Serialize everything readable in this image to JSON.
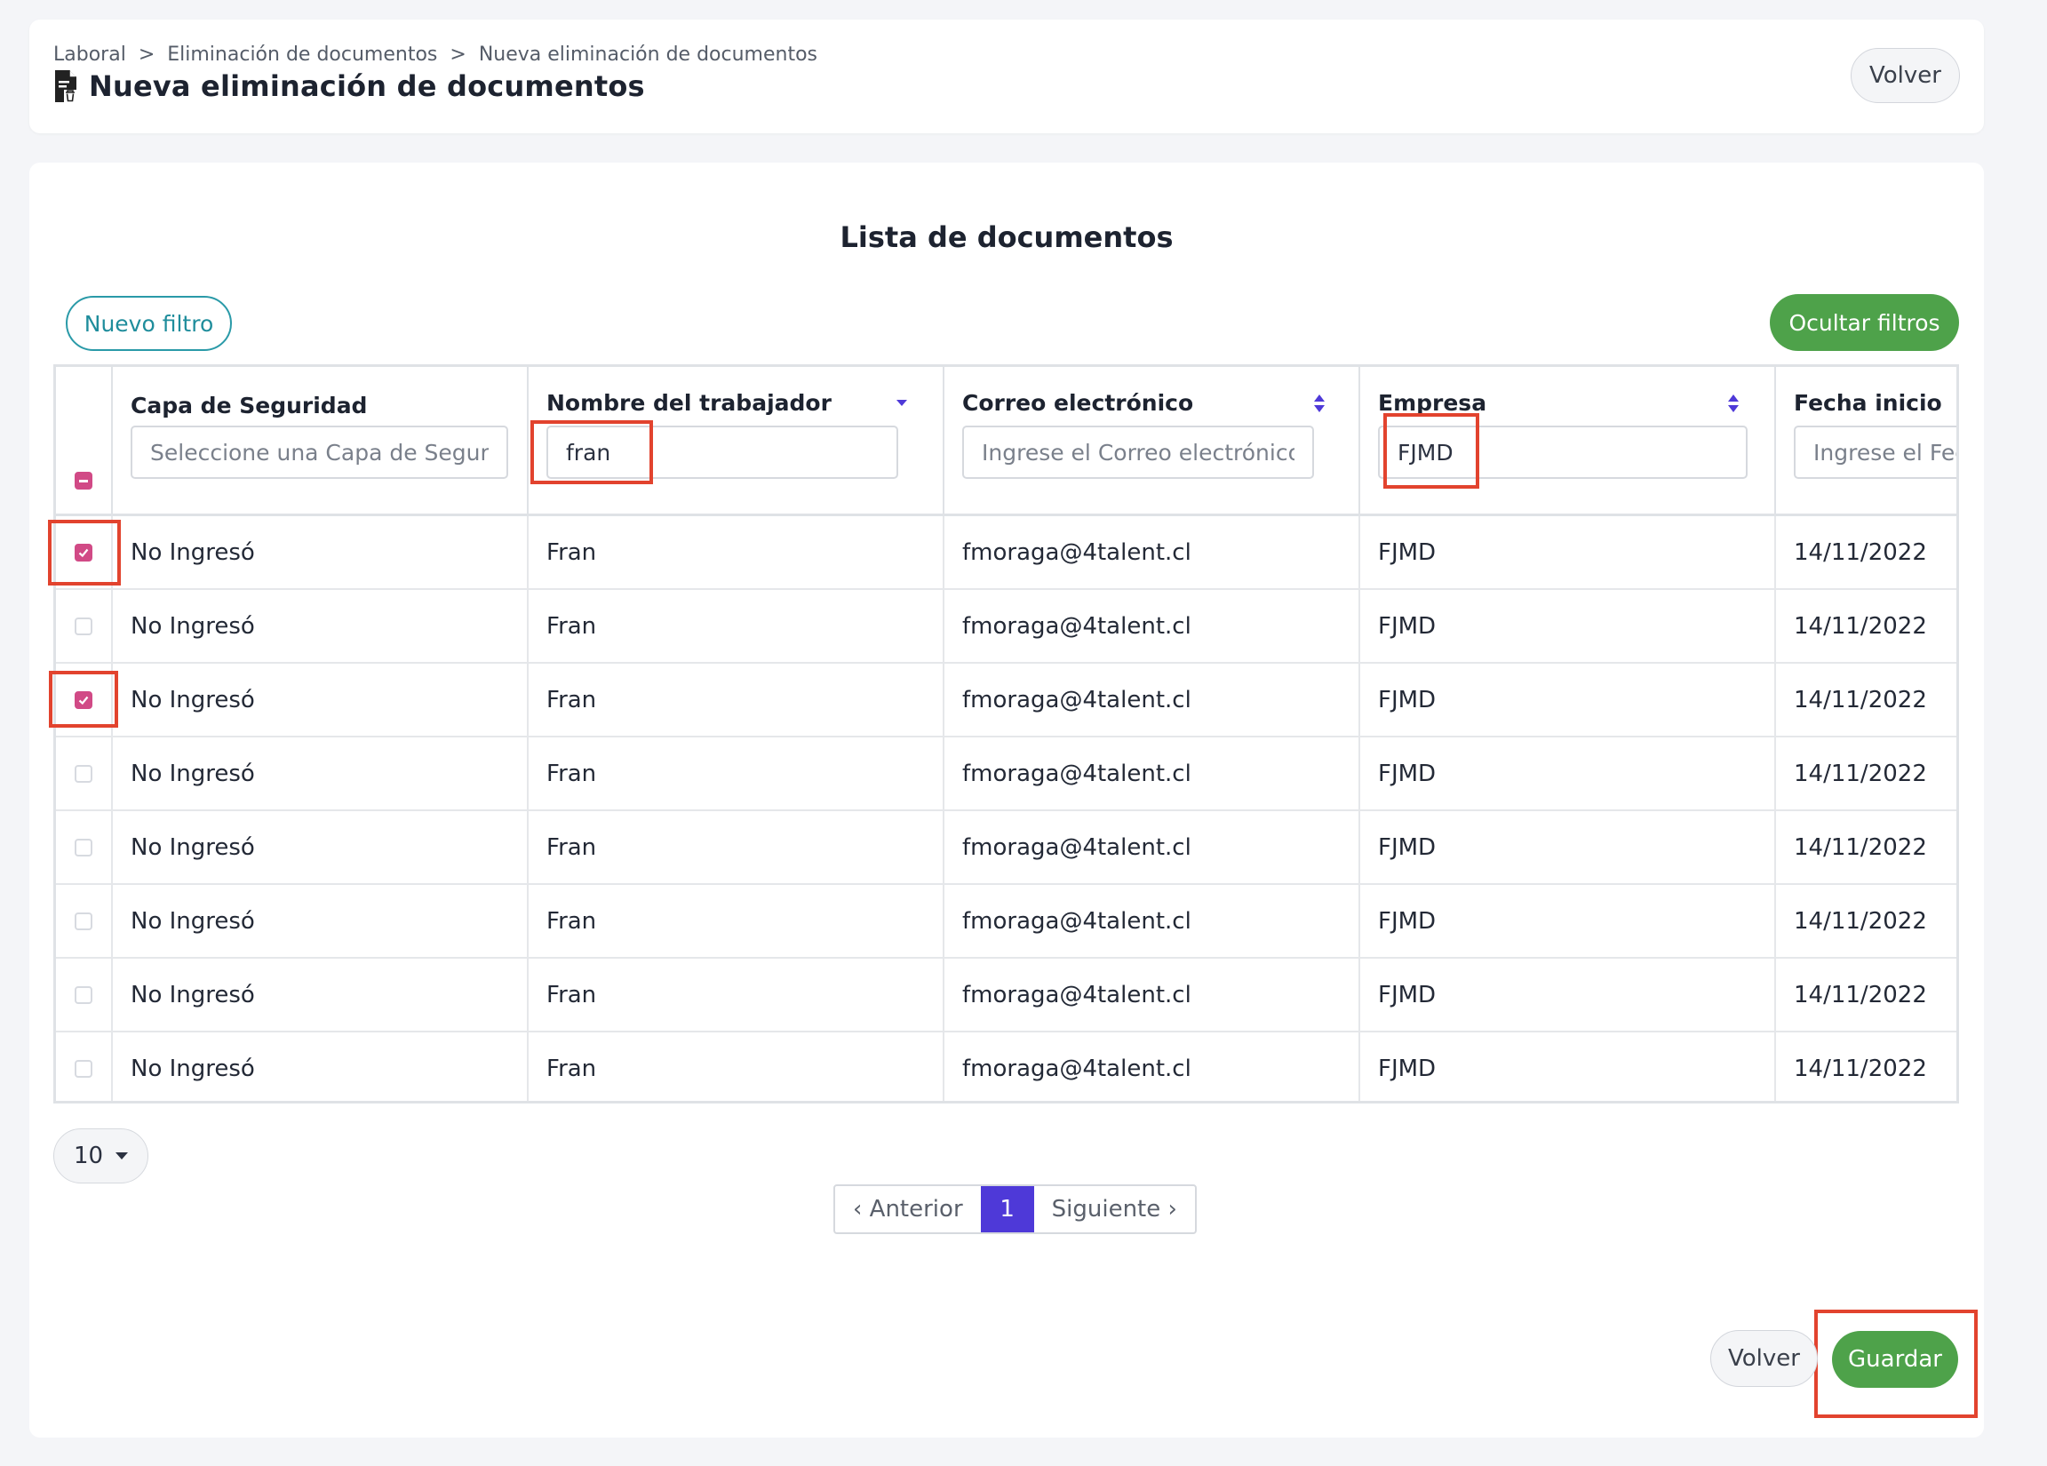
{
  "breadcrumb": [
    "Laboral",
    "Eliminación de documentos",
    "Nueva eliminación de documentos"
  ],
  "breadcrumb_separator": ">",
  "page_title": "Nueva eliminación de documentos",
  "header_back_label": "Volver",
  "section_title": "Lista de documentos",
  "new_filter_label": "Nuevo filtro",
  "hide_filters_label": "Ocultar filtros",
  "table": {
    "columns": [
      {
        "label": "Capa de Seguridad",
        "placeholder": "Seleccione una Capa de Seguridad",
        "value": ""
      },
      {
        "label": "Nombre del trabajador",
        "placeholder": "",
        "value": "fran"
      },
      {
        "label": "Correo electrónico",
        "placeholder": "Ingrese el Correo electrónico",
        "value": ""
      },
      {
        "label": "Empresa",
        "placeholder": "",
        "value": "FJMD"
      },
      {
        "label": "Fecha inicio",
        "placeholder": "Ingrese el Fecha inicio",
        "value": ""
      }
    ],
    "select_all_state": "indeterminate",
    "rows": [
      {
        "checked": true,
        "capa": "No Ingresó",
        "nombre": "Fran",
        "correo": "fmoraga@4talent.cl",
        "empresa": "FJMD",
        "fecha": "14/11/2022"
      },
      {
        "checked": false,
        "capa": "No Ingresó",
        "nombre": "Fran",
        "correo": "fmoraga@4talent.cl",
        "empresa": "FJMD",
        "fecha": "14/11/2022"
      },
      {
        "checked": true,
        "capa": "No Ingresó",
        "nombre": "Fran",
        "correo": "fmoraga@4talent.cl",
        "empresa": "FJMD",
        "fecha": "14/11/2022"
      },
      {
        "checked": false,
        "capa": "No Ingresó",
        "nombre": "Fran",
        "correo": "fmoraga@4talent.cl",
        "empresa": "FJMD",
        "fecha": "14/11/2022"
      },
      {
        "checked": false,
        "capa": "No Ingresó",
        "nombre": "Fran",
        "correo": "fmoraga@4talent.cl",
        "empresa": "FJMD",
        "fecha": "14/11/2022"
      },
      {
        "checked": false,
        "capa": "No Ingresó",
        "nombre": "Fran",
        "correo": "fmoraga@4talent.cl",
        "empresa": "FJMD",
        "fecha": "14/11/2022"
      },
      {
        "checked": false,
        "capa": "No Ingresó",
        "nombre": "Fran",
        "correo": "fmoraga@4talent.cl",
        "empresa": "FJMD",
        "fecha": "14/11/2022"
      },
      {
        "checked": false,
        "capa": "No Ingresó",
        "nombre": "Fran",
        "correo": "fmoraga@4talent.cl",
        "empresa": "FJMD",
        "fecha": "14/11/2022"
      }
    ]
  },
  "page_size": "10",
  "pagination": {
    "prev": "‹ Anterior",
    "current": "1",
    "next": "Siguiente ›"
  },
  "footer_back_label": "Volver",
  "save_label": "Guardar",
  "colors": {
    "accent_green": "#4ea24a",
    "accent_teal": "#2a9aa8",
    "checkbox_pink": "#d14a86",
    "pager_active": "#4e39d8",
    "sort_icon": "#4e39d8",
    "highlight_red": "#e2432e"
  },
  "icons": {
    "title_icon": "document-trash-icon",
    "sort_icon": "sort-icon",
    "page_size_icon": "caret-down-icon"
  }
}
